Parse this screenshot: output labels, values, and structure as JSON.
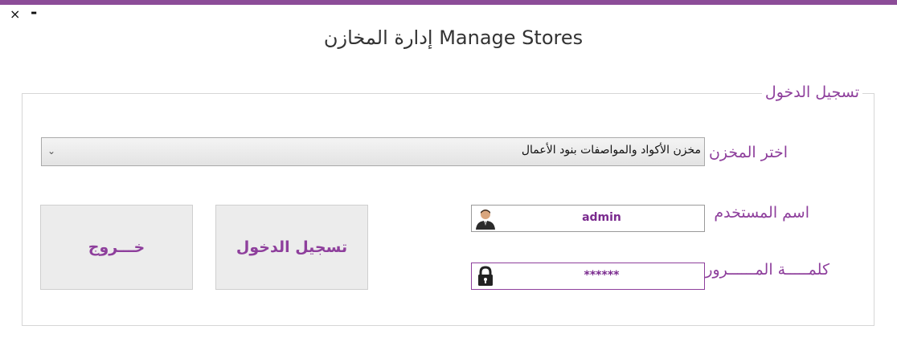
{
  "window": {
    "close_glyph": "×",
    "minimize_glyph": "-",
    "title": "إدارة المخازن Manage Stores"
  },
  "login_group": {
    "legend": "تسجيل الدخول",
    "store": {
      "label": "اختر المخزن",
      "selected": "مخزن الأكواد والمواصفات بنود الأعمال"
    },
    "username": {
      "label": "اسم المستخدم",
      "value": "admin",
      "icon": "user-avatar-icon"
    },
    "password": {
      "label": "كلمـــــة المــــــرور",
      "value": "******",
      "icon": "lock-icon"
    },
    "login_button": "تسجيل الدخول",
    "exit_button": "خـــروج"
  },
  "colors": {
    "accent": "#8e3f9c",
    "topbar": "#8c4c98"
  }
}
